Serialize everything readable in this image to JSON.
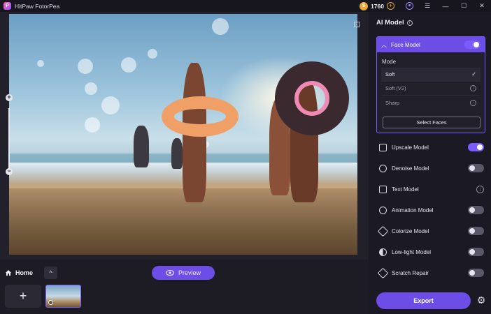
{
  "app": {
    "title": "HitPaw FotorPea",
    "logo_letter": "P"
  },
  "credits": {
    "value": "1760",
    "coin_glyph": "$",
    "add_glyph": "+"
  },
  "window": {
    "user_icon": "user-icon",
    "menu_glyph": "☰",
    "minimize_glyph": "—",
    "maximize_glyph": "☐",
    "close_glyph": "✕"
  },
  "canvas": {
    "crop_glyph": "⊡",
    "zoom_in_glyph": "+",
    "zoom_out_glyph": "−"
  },
  "bottom": {
    "home_label": "Home",
    "collapse_glyph": "^",
    "preview_label": "Preview",
    "add_glyph": "+"
  },
  "panel": {
    "title": "AI Model",
    "info_glyph": "i",
    "face_model": {
      "label": "Face Model",
      "enabled": true,
      "mode_label": "Mode",
      "options": [
        {
          "label": "Soft",
          "status": "selected",
          "glyph": "✓"
        },
        {
          "label": "Soft (V2)",
          "status": "download",
          "glyph": "↓"
        },
        {
          "label": "Sharp",
          "status": "download",
          "glyph": "↓"
        }
      ],
      "select_faces_label": "Select Faces"
    },
    "models": [
      {
        "label": "Upscale Model",
        "control": "toggle",
        "on": true,
        "icon": "upscale-icon"
      },
      {
        "label": "Denoise Model",
        "control": "toggle",
        "on": false,
        "icon": "denoise-icon"
      },
      {
        "label": "Text Model",
        "control": "download",
        "glyph": "↓",
        "icon": "text-icon"
      },
      {
        "label": "Animation Model",
        "control": "toggle",
        "on": false,
        "icon": "animation-icon"
      },
      {
        "label": "Colorize Model",
        "control": "toggle",
        "on": false,
        "icon": "colorize-icon"
      },
      {
        "label": "Low-light Model",
        "control": "toggle",
        "on": false,
        "icon": "low-light-icon"
      },
      {
        "label": "Scratch Repair",
        "control": "toggle",
        "on": false,
        "icon": "scratch-repair-icon"
      }
    ],
    "export_label": "Export",
    "settings_glyph": "⚙"
  },
  "colors": {
    "accent": "#6c4de6",
    "accent_border": "#7a5cff",
    "panel_bg": "#1b1a24",
    "coin": "#e6a93a"
  }
}
